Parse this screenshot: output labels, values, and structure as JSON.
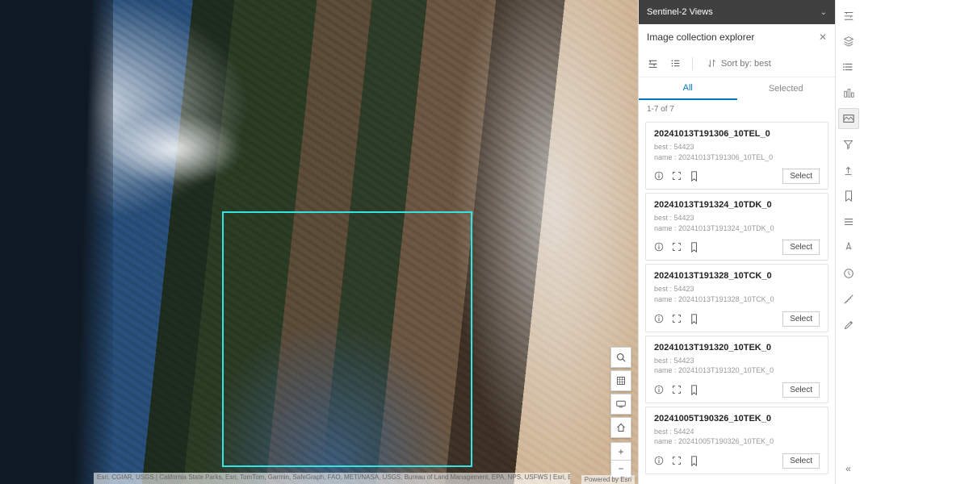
{
  "header": {
    "layer_title": "Sentinel-2 Views"
  },
  "explorer": {
    "title": "Image collection explorer",
    "sort_label": "Sort by: best",
    "tabs": {
      "all": "All",
      "selected": "Selected"
    },
    "count": "1-7 of 7",
    "select_label": "Select",
    "best_prefix": "best : ",
    "name_prefix": "name : ",
    "items": [
      {
        "title": "20241013T191306_10TEL_0",
        "best": "54423",
        "name": "20241013T191306_10TEL_0"
      },
      {
        "title": "20241013T191324_10TDK_0",
        "best": "54423",
        "name": "20241013T191324_10TDK_0"
      },
      {
        "title": "20241013T191328_10TCK_0",
        "best": "54423",
        "name": "20241013T191328_10TCK_0"
      },
      {
        "title": "20241013T191320_10TEK_0",
        "best": "54423",
        "name": "20241013T191320_10TEK_0"
      },
      {
        "title": "20241005T190326_10TEK_0",
        "best": "54424",
        "name": "20241005T190326_10TEK_0"
      }
    ]
  },
  "map": {
    "attribution": "Esri, CGIAR, USGS | California State Parks, Esri, TomTom, Garmin, SafeGraph, FAO, METI/NASA, USGS, Bureau of Land Management, EPA, NPS, USFWS | Esri, Europe...",
    "powered": "Powered by Esri",
    "zoom_in": "+",
    "zoom_out": "−"
  }
}
